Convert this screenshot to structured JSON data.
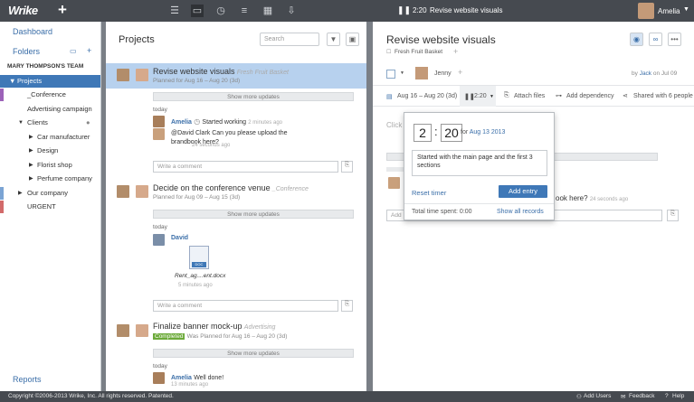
{
  "topbar": {
    "logo": "Wrike",
    "plus": "+",
    "timer_time": "2:20",
    "timer_task": "Revise website visuals",
    "user": "Amelia"
  },
  "sidebar": {
    "dashboard": "Dashboard",
    "folders": "Folders",
    "team": "MARY THOMPSON'S TEAM",
    "items": [
      {
        "label": "Projects",
        "toggle": "▼",
        "selected": true
      },
      {
        "label": "_Conference"
      },
      {
        "label": "Advertising campaign"
      },
      {
        "label": "Clients",
        "toggle": "▼"
      },
      {
        "label": "Car manufacturer",
        "toggle": "▶"
      },
      {
        "label": "Design",
        "toggle": "▶"
      },
      {
        "label": "Florist shop",
        "toggle": "▶"
      },
      {
        "label": "Perfume company",
        "toggle": "▶"
      },
      {
        "label": "Our company",
        "toggle": "▶"
      },
      {
        "label": "URGENT"
      }
    ],
    "reports": "Reports"
  },
  "projects": {
    "title": "Projects",
    "search_placeholder": "Search",
    "tasks": [
      {
        "name": "Revise website visuals",
        "project": "Fresh Fruit Basket",
        "plan": "Planned for Aug 16 – Aug 20 (3d)",
        "show_more": "Show more updates",
        "today": "today",
        "activity_name": "Amelia",
        "activity_text": "Started working",
        "activity_time": "2 minutes ago",
        "comment_text": "@David Clark Can you please upload the brandbook here?",
        "comment_time": "24 seconds ago",
        "write_comment": "Write a comment"
      },
      {
        "name": "Decide on the conference venue",
        "project": "_Conference",
        "plan": "Planned for Aug 09 – Aug 15 (3d)",
        "show_more": "Show more updates",
        "today": "today",
        "activity_name": "David",
        "file_name": "Rent_ag....ent.docx",
        "file_ext": "DOC",
        "file_time": "5 minutes ago",
        "write_comment": "Write a comment"
      },
      {
        "name": "Finalize banner mock-up",
        "project": "Advertising",
        "badge": "Completed",
        "plan": "Was Planned for Aug 16 – Aug 20 (3d)",
        "show_more": "Show more updates",
        "today": "today",
        "activity_name": "Amelia",
        "comment_text": "Well done!",
        "comment_time": "13 minutes ago"
      }
    ]
  },
  "detail": {
    "title": "Revise website visuals",
    "tag": "Fresh Fruit Basket",
    "assignee": "Jenny",
    "byline_prefix": "by",
    "byline_user": "Jack",
    "byline_suffix": "on Jul 09",
    "dates": "Aug 16 – Aug 20 (3d)",
    "timer": "2:20",
    "attach": "Attach files",
    "add_dependency": "Add dependency",
    "shared": "Shared with 6 people",
    "click_placeholder": "Click",
    "comment_fragment": "ook here?",
    "comment_time": "24 seconds ago",
    "add_placeholder": "Add"
  },
  "popup": {
    "hours": "2",
    "minutes": "20",
    "for_label": "for",
    "date": "Aug 13 2013",
    "notes": "Started with the main page and the first 3 sections",
    "reset": "Reset timer",
    "add_entry": "Add entry",
    "total_label": "Total time spent:",
    "total_value": "0:00",
    "show_all": "Show all records"
  },
  "footer": {
    "copyright": "Copyright ©2006-2013 Wrike, Inc. All rights reserved. Patented.",
    "add_users": "Add Users",
    "feedback": "Feedback",
    "help": "Help"
  },
  "colors": {
    "topbar": "#464a50",
    "accent": "#3f78b7",
    "completed": "#6caa3a"
  }
}
